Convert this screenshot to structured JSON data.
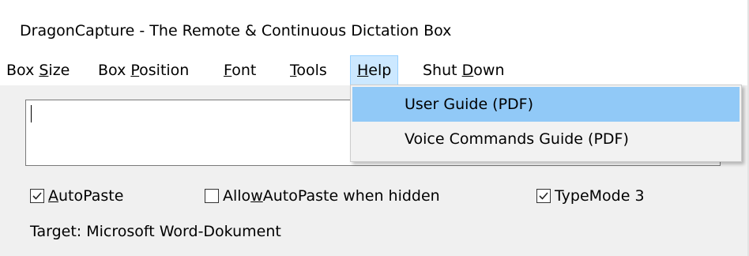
{
  "window": {
    "title": "DragonCapture - The Remote & Continuous Dictation Box"
  },
  "menubar": {
    "items": [
      {
        "pre": "Box ",
        "ul": "S",
        "post": "ize"
      },
      {
        "pre": "Box ",
        "ul": "P",
        "post": "osition"
      },
      {
        "pre": "",
        "ul": "F",
        "post": "ont"
      },
      {
        "pre": "",
        "ul": "T",
        "post": "ools"
      },
      {
        "pre": "",
        "ul": "H",
        "post": "elp"
      },
      {
        "pre": "Shut ",
        "ul": "D",
        "post": "own"
      }
    ],
    "active_item": "Help"
  },
  "help_menu": {
    "items": [
      {
        "label": "User Guide (PDF)",
        "highlighted": true
      },
      {
        "label": "Voice Commands Guide (PDF)",
        "highlighted": false
      }
    ]
  },
  "dictation_box": {
    "value": ""
  },
  "options": {
    "autopaste": {
      "pre": "",
      "ul": "A",
      "post": "utoPaste",
      "checked": true
    },
    "allow_hidden": {
      "pre": "Allo",
      "ul": "w",
      "post": " AutoPaste when hidden",
      "checked": false
    },
    "typemode": {
      "pre": "TypeMode 3",
      "ul": "",
      "post": "",
      "checked": true
    }
  },
  "status": {
    "target_text": "Target: Microsoft Word-Dokument"
  },
  "colors": {
    "menu_active_bg": "#cce8ff",
    "menu_highlight_bg": "#91c9f7",
    "client_bg": "#f0f0f0"
  }
}
